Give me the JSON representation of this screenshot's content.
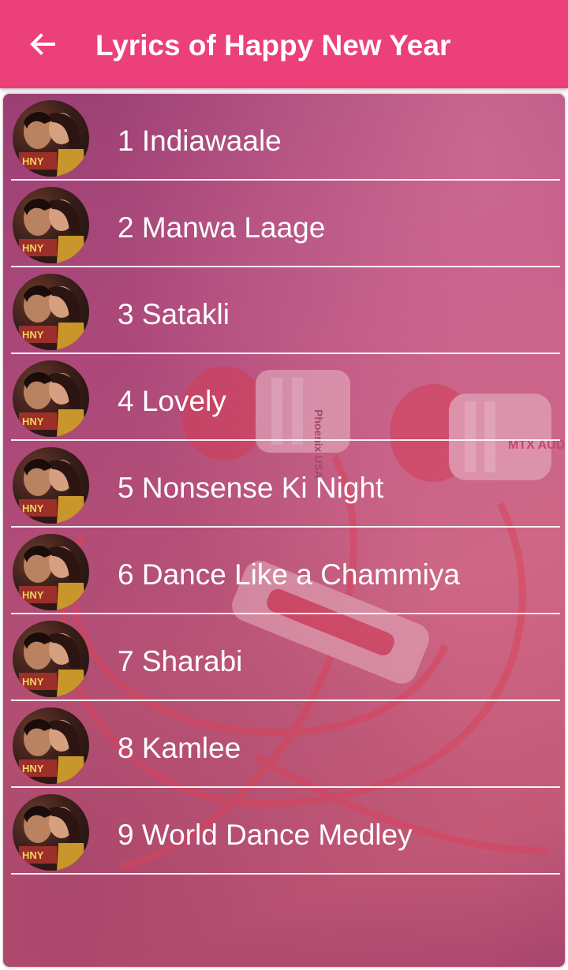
{
  "app_bar": {
    "title": "Lyrics of Happy New Year",
    "background": "#ec407a",
    "back_icon": "arrow-back-icon"
  },
  "songs": [
    {
      "number": "1",
      "title": "1 Indiawaale"
    },
    {
      "number": "2",
      "title": "2 Manwa Laage"
    },
    {
      "number": "3",
      "title": "3 Satakli"
    },
    {
      "number": "4",
      "title": "4 Lovely"
    },
    {
      "number": "5",
      "title": "5 Nonsense Ki Night"
    },
    {
      "number": "6",
      "title": "6 Dance Like a Chammiya"
    },
    {
      "number": "7",
      "title": "7 Sharabi"
    },
    {
      "number": "8",
      "title": "8 Kamlee"
    },
    {
      "number": "9",
      "title": "9 World Dance Medley"
    }
  ],
  "background_art": {
    "subject": "earphones",
    "brand_text": "MTX AUDIO",
    "engraving": "Phoenix USA"
  }
}
